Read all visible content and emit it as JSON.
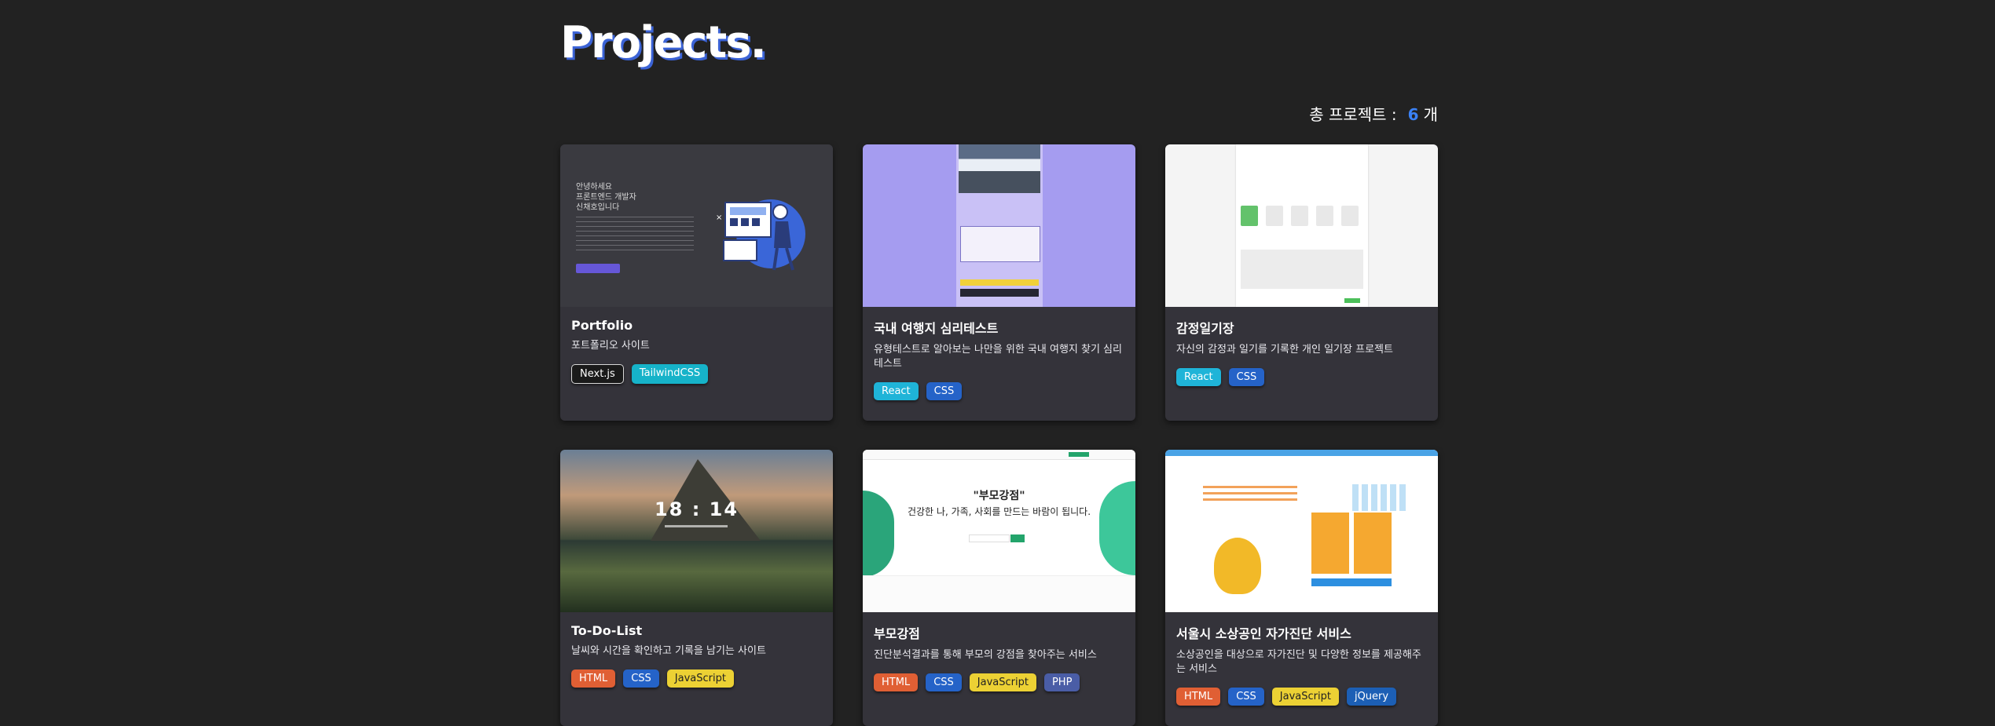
{
  "page": {
    "title": "Projects."
  },
  "summary": {
    "prefix": "총 프로젝트 :",
    "count": "6",
    "suffix": "개"
  },
  "colors": {
    "background": "#222222",
    "card": "#34333a",
    "accent": "#3b82f6",
    "tag_nextjs": "#1a1a1a",
    "tag_tailwind": "#16b3c9",
    "tag_react": "#1fb4d8",
    "tag_css": "#2563c8",
    "tag_html": "#e05f34",
    "tag_javascript": "#ecd134",
    "tag_php": "#4a5da6",
    "tag_jquery": "#1c5fb5"
  },
  "projects": [
    {
      "name": "Portfolio",
      "description": "포트폴리오 사이트",
      "thumbnail": {
        "text": [
          "안녕하세요",
          "프론트엔드 개발자",
          "신채호입니다"
        ]
      },
      "tags": [
        "Next.js",
        "TailwindCSS"
      ]
    },
    {
      "name": "국내 여행지 심리테스트",
      "description": "유형테스트로 알아보는 나만을 위한 국내 여행지 찾기 심리테스트",
      "tags": [
        "React",
        "CSS"
      ]
    },
    {
      "name": "감정일기장",
      "description": "자신의 감정과 일기를 기록한 개인 일기장 프로젝트",
      "tags": [
        "React",
        "CSS"
      ]
    },
    {
      "name": "To-Do-List",
      "description": "날씨와 시간을 확인하고 기록을 남기는 사이트",
      "thumbnail": {
        "clock": "18 : 14"
      },
      "tags": [
        "HTML",
        "CSS",
        "JavaScript"
      ]
    },
    {
      "name": "부모강점",
      "description": "진단분석결과를 통해 부모의 강점을 찾아주는 서비스",
      "thumbnail": {
        "headline": "\"부모강점\"",
        "subline": "건강한 나, 가족, 사회를 만드는 바람이 됩니다."
      },
      "tags": [
        "HTML",
        "CSS",
        "JavaScript",
        "PHP"
      ]
    },
    {
      "name": "서울시 소상공인 자가진단 서비스",
      "description": "소상공인을 대상으로 자가진단 및 다양한 정보를 제공해주는 서비스",
      "tags": [
        "HTML",
        "CSS",
        "JavaScript",
        "jQuery"
      ]
    }
  ]
}
